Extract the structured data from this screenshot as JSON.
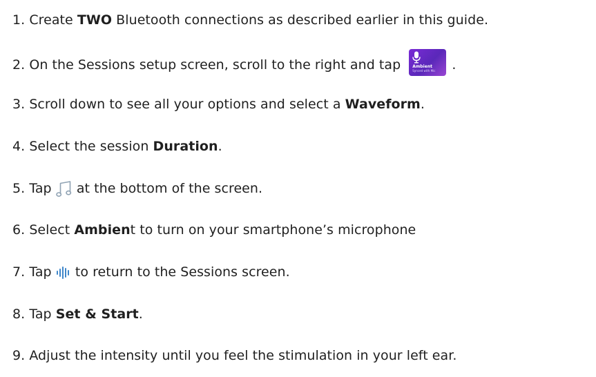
{
  "steps": [
    {
      "num": "1.",
      "pre": " Create ",
      "bold": "TWO",
      "post": " Bluetooth connections as described earlier in this guide."
    },
    {
      "num": "2.",
      "pre": " On the Sessions setup screen, scroll to the right and tap ",
      "post": " ."
    },
    {
      "num": "3.",
      "pre": " Scroll down to see all your options and select a ",
      "bold": "Waveform",
      "post": "."
    },
    {
      "num": "4.",
      "pre": " Select the session ",
      "bold": "Duration",
      "post": "."
    },
    {
      "num": "5.",
      "pre": " Tap ",
      "post": " at the bottom of the screen."
    },
    {
      "num": "6.",
      "pre": " Select ",
      "bold": "Ambien",
      "post": "t to turn on your smartphone’s microphone"
    },
    {
      "num": "7.",
      "pre": " Tap ",
      "post": " to return to the Sessions screen."
    },
    {
      "num": "8.",
      "pre": " Tap ",
      "bold": "Set & Start",
      "post": "."
    },
    {
      "num": "9.",
      "pre": " Adjust the intensity until you feel the stimulation in your left ear."
    }
  ],
  "ambient_tile": {
    "title": "Ambient",
    "subtitle": "Synced with Mic"
  },
  "icons": {
    "tile_icon": "microphone-icon",
    "music_icon": "music-note-icon",
    "waveform_icon": "waveform-icon"
  },
  "colors": {
    "text": "#1f1f1f",
    "tile_gradient_start": "#7a2bd6",
    "tile_gradient_end": "#9a46d3",
    "music_icon": "#8fa2b3",
    "waveform_icon": "#3e86c9"
  }
}
